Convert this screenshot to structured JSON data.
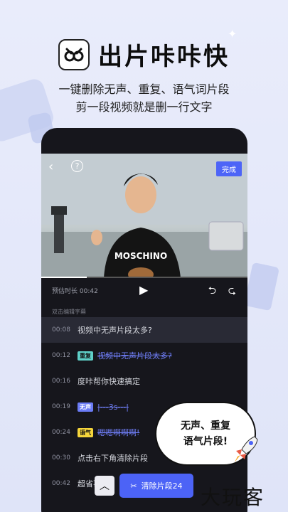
{
  "header": {
    "title": "出片咔咔快",
    "subtitle1": "一键删除无声、重复、语气词片段",
    "subtitle2": "剪一段视频就是删一行文字"
  },
  "player": {
    "done_label": "完成",
    "estimate_label": "预估时长 00:42",
    "progress": 0.22
  },
  "editor": {
    "hint": "双击编辑字幕",
    "rows": [
      {
        "time": "00:08",
        "tag": "",
        "text": "视频中无声片段太多?",
        "struck": false,
        "highlight": true
      },
      {
        "time": "00:12",
        "tag": "重复",
        "tag_type": "repeat",
        "text": "视频中无声片段太多?",
        "struck": true,
        "highlight": false
      },
      {
        "time": "00:16",
        "tag": "",
        "text": "度咔帮你快速搞定",
        "struck": false,
        "highlight": false
      },
      {
        "time": "00:19",
        "tag": "无声",
        "tag_type": "silent",
        "text": "|---3s---|",
        "struck": true,
        "highlight": false
      },
      {
        "time": "00:24",
        "tag": "语气",
        "tag_type": "filler",
        "text": "嗯嗯啊啊啊!",
        "struck": true,
        "highlight": false
      },
      {
        "time": "00:30",
        "tag": "",
        "text": "点击右下角清除片段",
        "struck": false,
        "highlight": false
      },
      {
        "time": "00:42",
        "tag": "",
        "text": "超省事儿",
        "struck": false,
        "highlight": false
      }
    ],
    "clear_label": "清除片段24"
  },
  "bubble": {
    "line1": "无声、重复",
    "line2": "语气片段!"
  },
  "watermark": "大玩客",
  "colors": {
    "accent": "#4c63f6",
    "background": "#e6e9fa"
  }
}
